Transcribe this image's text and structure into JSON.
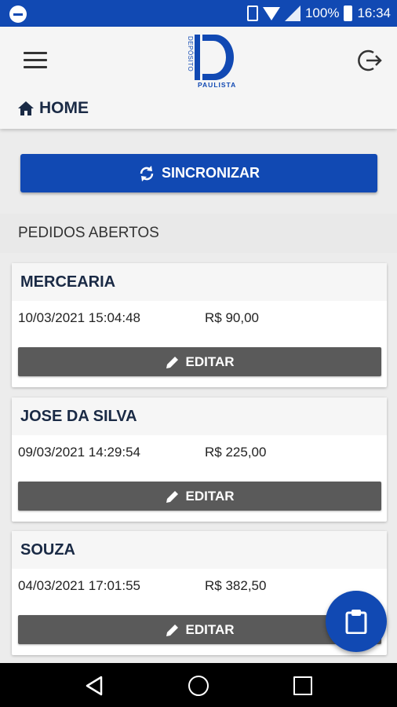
{
  "status_bar": {
    "battery": "100%",
    "time": "16:34"
  },
  "header": {
    "logo_top_text": "DEPÓSITO",
    "logo_bottom_text": "PAULISTA",
    "breadcrumb": "HOME"
  },
  "sync_button": {
    "label": "SINCRONIZAR"
  },
  "section": {
    "title": "PEDIDOS ABERTOS"
  },
  "orders": [
    {
      "name": "MERCEARIA",
      "datetime": "10/03/2021 15:04:48",
      "total": "R$ 90,00",
      "edit_label": "EDITAR"
    },
    {
      "name": "JOSE DA SILVA",
      "datetime": "09/03/2021 14:29:54",
      "total": "R$ 225,00",
      "edit_label": "EDITAR"
    },
    {
      "name": "SOUZA",
      "datetime": "04/03/2021 17:01:55",
      "total": "R$ 382,50",
      "edit_label": "EDITAR"
    }
  ],
  "colors": {
    "primary": "#1149b3",
    "button_dark": "#5a5a5a",
    "title_text": "#1a2a45"
  },
  "icons": [
    "menu-icon",
    "logout-icon",
    "home-icon",
    "sync-icon",
    "pencil-icon",
    "clipboard-icon",
    "back-icon",
    "home-circle-icon",
    "recents-icon"
  ]
}
